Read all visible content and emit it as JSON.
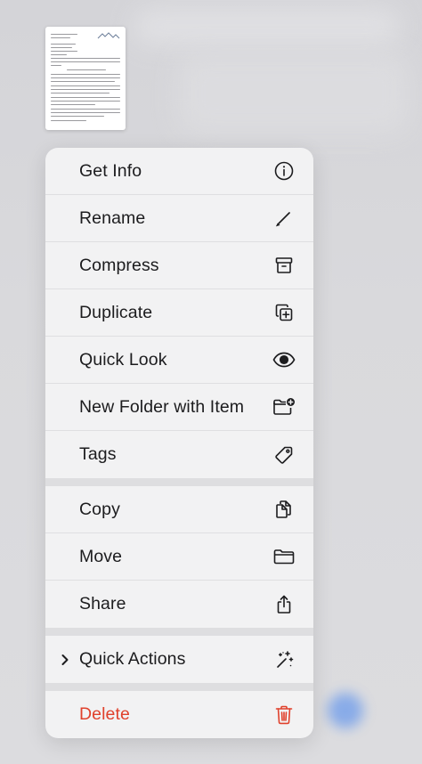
{
  "menu": {
    "items": [
      {
        "label": "Get Info",
        "icon": "info-circle-icon"
      },
      {
        "label": "Rename",
        "icon": "pencil-icon"
      },
      {
        "label": "Compress",
        "icon": "archive-box-icon"
      },
      {
        "label": "Duplicate",
        "icon": "duplicate-plus-icon"
      },
      {
        "label": "Quick Look",
        "icon": "eye-icon"
      },
      {
        "label": "New Folder with Item",
        "icon": "folder-plus-icon"
      },
      {
        "label": "Tags",
        "icon": "tag-icon"
      },
      {
        "label": "Copy",
        "icon": "copy-docs-icon"
      },
      {
        "label": "Move",
        "icon": "folder-icon"
      },
      {
        "label": "Share",
        "icon": "share-icon"
      },
      {
        "label": "Quick Actions",
        "icon": "sparkles-wand-icon"
      },
      {
        "label": "Delete",
        "icon": "trash-icon"
      }
    ]
  },
  "colors": {
    "menu_background": "#f2f2f3",
    "destructive": "#e0412c",
    "text": "#1c1c1e"
  }
}
